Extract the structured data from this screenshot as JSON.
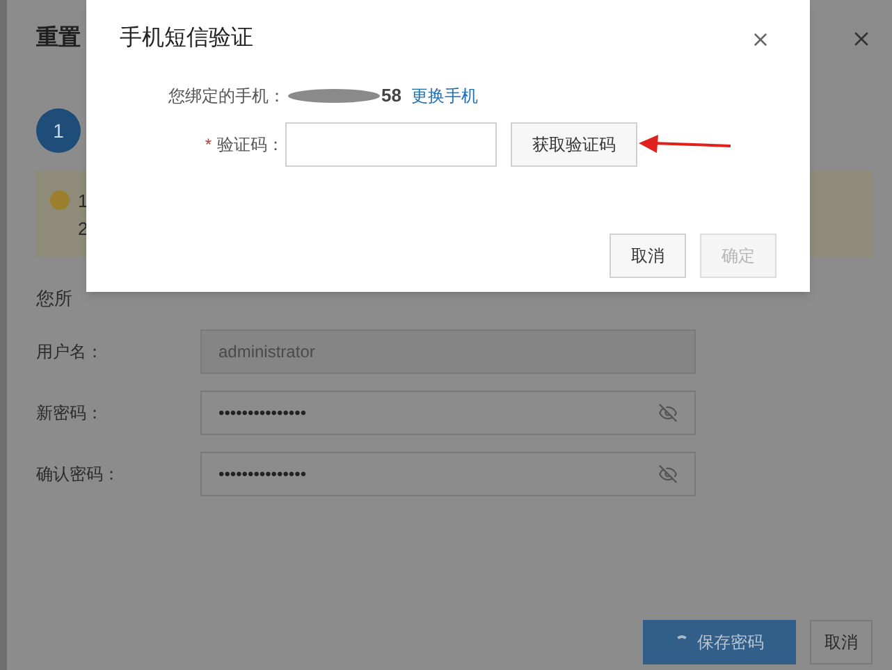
{
  "background_dialog": {
    "title": "重置",
    "step": "1",
    "notice_lines": [
      "1",
      "2"
    ],
    "intro": "您所",
    "fields": [
      {
        "label": "用户名：",
        "value": "administrator",
        "disabled": true,
        "kind": "text"
      },
      {
        "label": "新密码：",
        "value": "•••••••••••••••",
        "disabled": false,
        "kind": "password"
      },
      {
        "label": "确认密码：",
        "value": "•••••••••••••••",
        "disabled": false,
        "kind": "password"
      }
    ],
    "buttons": [
      {
        "label": "保存密码",
        "kind": "primary",
        "loading": true
      },
      {
        "label": "取消",
        "kind": "default",
        "loading": false
      }
    ]
  },
  "sms_dialog": {
    "title": "手机短信验证",
    "phone_label": "您绑定的手机：",
    "phone_visible": "58",
    "change_phone_link": "更换手机",
    "code_label": "验证码：",
    "required_mark": "*",
    "get_code_button": "获取验证码",
    "buttons": [
      {
        "label": "取消",
        "disabled": false
      },
      {
        "label": "确定",
        "disabled": true
      }
    ]
  }
}
